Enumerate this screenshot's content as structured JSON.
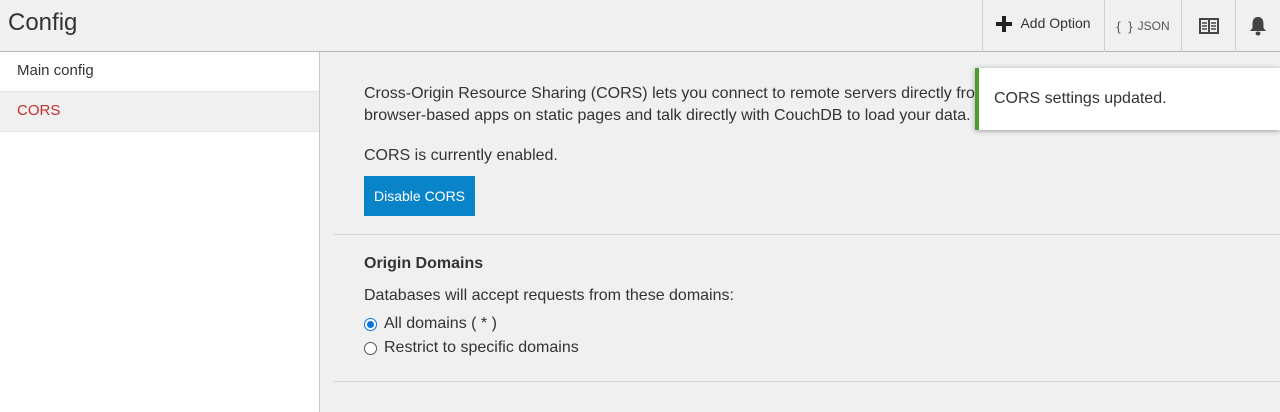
{
  "header": {
    "title": "Config",
    "add_option_label": "Add Option",
    "json_braces": "{ }",
    "json_label": "JSON",
    "docs_icon": "book-icon",
    "notifications_icon": "bell-icon"
  },
  "sidebar": {
    "items": [
      {
        "label": "Main config",
        "active": false
      },
      {
        "label": "CORS",
        "active": true
      }
    ]
  },
  "main": {
    "intro_line1": "Cross-Origin Resource Sharing (CORS) lets you connect to remote servers directly from",
    "intro_line2": "browser-based apps on static pages and talk directly with CouchDB to load your data.",
    "status": "CORS is currently enabled.",
    "disable_button": "Disable CORS",
    "origin_heading": "Origin Domains",
    "origin_description": "Databases will accept requests from these domains:",
    "options": [
      {
        "label": "All domains ( * )",
        "selected": true
      },
      {
        "label": "Restrict to specific domains",
        "selected": false
      }
    ]
  },
  "notification": {
    "message": "CORS settings updated.",
    "type": "success"
  },
  "colors": {
    "accent_button": "#0a84c8",
    "active_sidebar_text": "#c03030",
    "success_border": "#4a9d2f",
    "radio_selected": "#0a74d8"
  }
}
